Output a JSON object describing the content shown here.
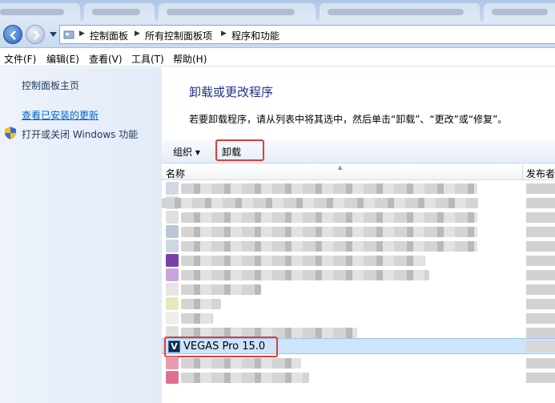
{
  "breadcrumb": [
    "控制面板",
    "所有控制面板项",
    "程序和功能"
  ],
  "menu": [
    "文件(F)",
    "编辑(E)",
    "查看(V)",
    "工具(T)",
    "帮助(H)"
  ],
  "sidebar": {
    "home": "控制面板主页",
    "updates": "查看已安装的更新",
    "features": "打开或关闭 Windows 功能"
  },
  "main": {
    "title": "卸载或更改程序",
    "description": "若要卸载程序，请从列表中将其选中，然后单击“卸载”、“更改”或“修复”。"
  },
  "toolbar": {
    "organize": "组织 ▾",
    "uninstall": "卸载"
  },
  "columns": {
    "name": "名称",
    "publisher": "发布者"
  },
  "programs": {
    "selected": {
      "name": "VEGAS Pro 15.0",
      "icon": "vegas-icon"
    }
  },
  "colors": {
    "highlight": "#e23b3b",
    "selection": "#cde4fb",
    "link": "#0066cc",
    "title": "#1e3287"
  }
}
